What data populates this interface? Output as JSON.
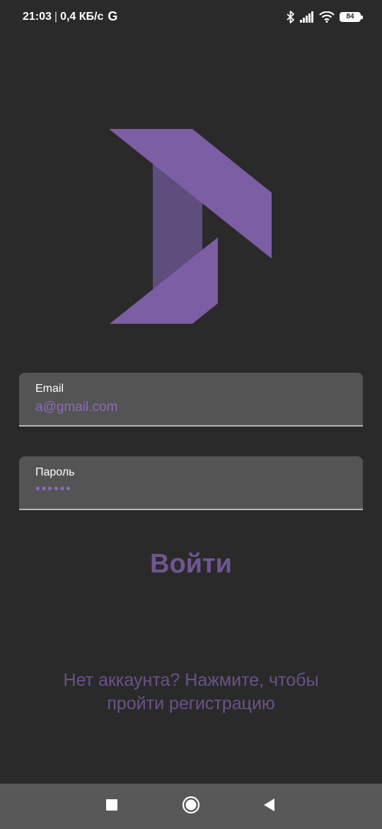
{
  "status_bar": {
    "time": "21:03",
    "separator": "|",
    "network_speed": "0,4 КБ/с",
    "google_icon_letter": "G",
    "battery_level": "84",
    "icons": [
      "bluetooth-icon",
      "signal-icon",
      "wifi-icon",
      "battery-icon"
    ]
  },
  "logo": {
    "name": "app-logo",
    "colors": {
      "primary": "#7b5ea4",
      "shadow": "#5f4d7e"
    }
  },
  "form": {
    "email": {
      "label": "Email",
      "value": "a@gmail.com"
    },
    "password": {
      "label": "Пароль",
      "value": "••••••"
    }
  },
  "login_button": {
    "label": "Войти"
  },
  "register_link": {
    "line1": "Нет аккаунта? Нажмите, чтобы",
    "line2": "пройти регистрацию"
  },
  "nav_bar": {
    "buttons": [
      "recent-apps-icon",
      "home-icon",
      "back-icon"
    ]
  },
  "theme": {
    "background": "#2a2a2a",
    "field_background": "#545454",
    "accent": "#8e6ab8",
    "button_text": "#6f5691",
    "nav_background": "#585858"
  }
}
